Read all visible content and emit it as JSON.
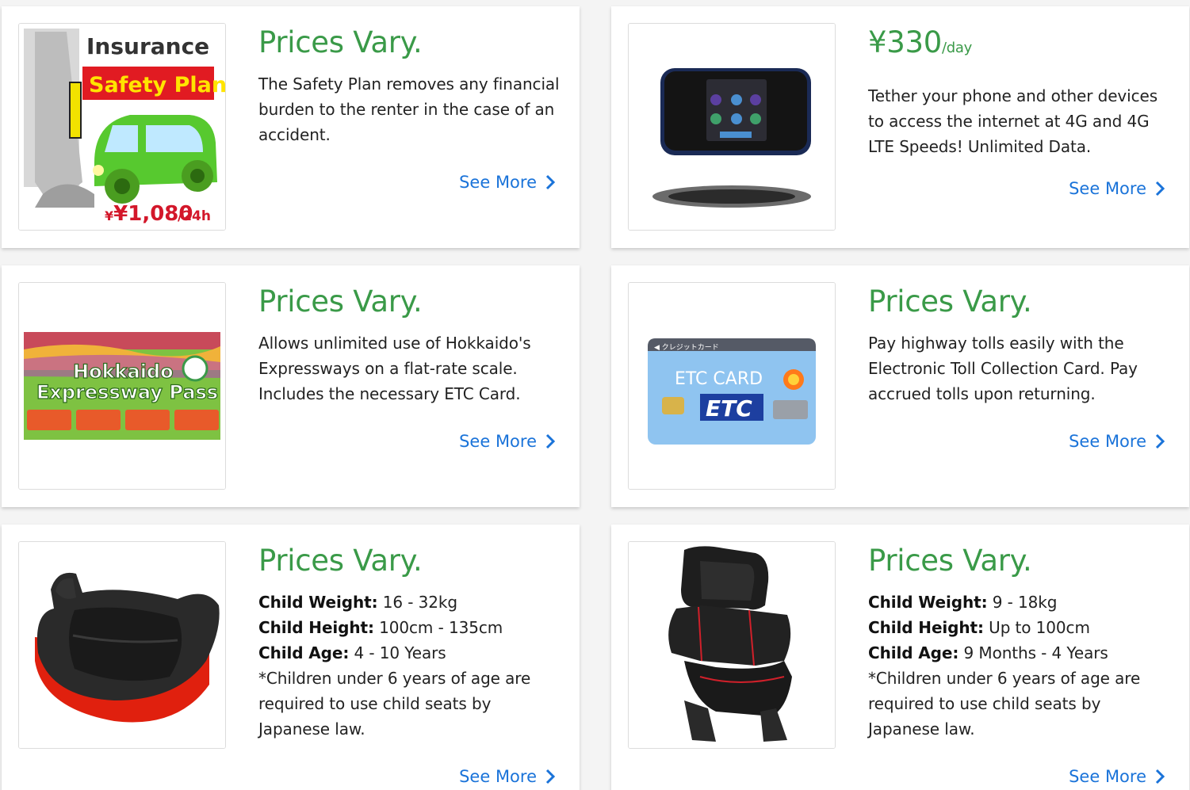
{
  "see_more_label": "See More",
  "cards": [
    {
      "price": "Prices Vary.",
      "description": "The Safety Plan removes any financial burden to the renter in the case of an accident.",
      "image": {
        "title": "Insurance",
        "banner": "Safety Plan",
        "price": "¥1,080",
        "price_unit": "/24h"
      }
    },
    {
      "price": "¥330",
      "price_unit": "/day",
      "description": "Tether your phone and other devices to access the internet at 4G and 4G LTE Speeds! Unlimited Data.",
      "image": {
        "subject": "pocket-wifi-router"
      }
    },
    {
      "price": "Prices Vary.",
      "description": "Allows unlimited use of Hokkaido's Expressways on a flat-rate scale. Includes the necessary ETC Card.",
      "image": {
        "line1": "Hokkaido",
        "line2": "Expressway Pass"
      }
    },
    {
      "price": "Prices Vary.",
      "description": "Pay highway tolls easily with the Electronic Toll Collection Card. Pay accrued tolls upon returning.",
      "image": {
        "header": "クレジットカード",
        "title": "ETC CARD",
        "logo": "ETC"
      }
    },
    {
      "price": "Prices Vary.",
      "specs": [
        {
          "label": "Child Weight:",
          "value": "16 - 32kg"
        },
        {
          "label": "Child Height:",
          "value": "100cm - 135cm"
        },
        {
          "label": "Child Age:",
          "value": "4 - 10 Years"
        }
      ],
      "note": "*Children under 6 years of age are required to use child seats by Japanese law.",
      "image": {
        "subject": "booster-seat"
      }
    },
    {
      "price": "Prices Vary.",
      "specs": [
        {
          "label": "Child Weight:",
          "value": "9 - 18kg"
        },
        {
          "label": "Child Height:",
          "value": "Up to 100cm"
        },
        {
          "label": "Child Age:",
          "value": "9 Months - 4 Years"
        }
      ],
      "note": "*Children under 6 years of age are required to use child seats by Japanese law.",
      "image": {
        "subject": "high-back-child-seat"
      }
    }
  ],
  "colors": {
    "price_green": "#3a9a48",
    "link_blue": "#1a73d9"
  }
}
